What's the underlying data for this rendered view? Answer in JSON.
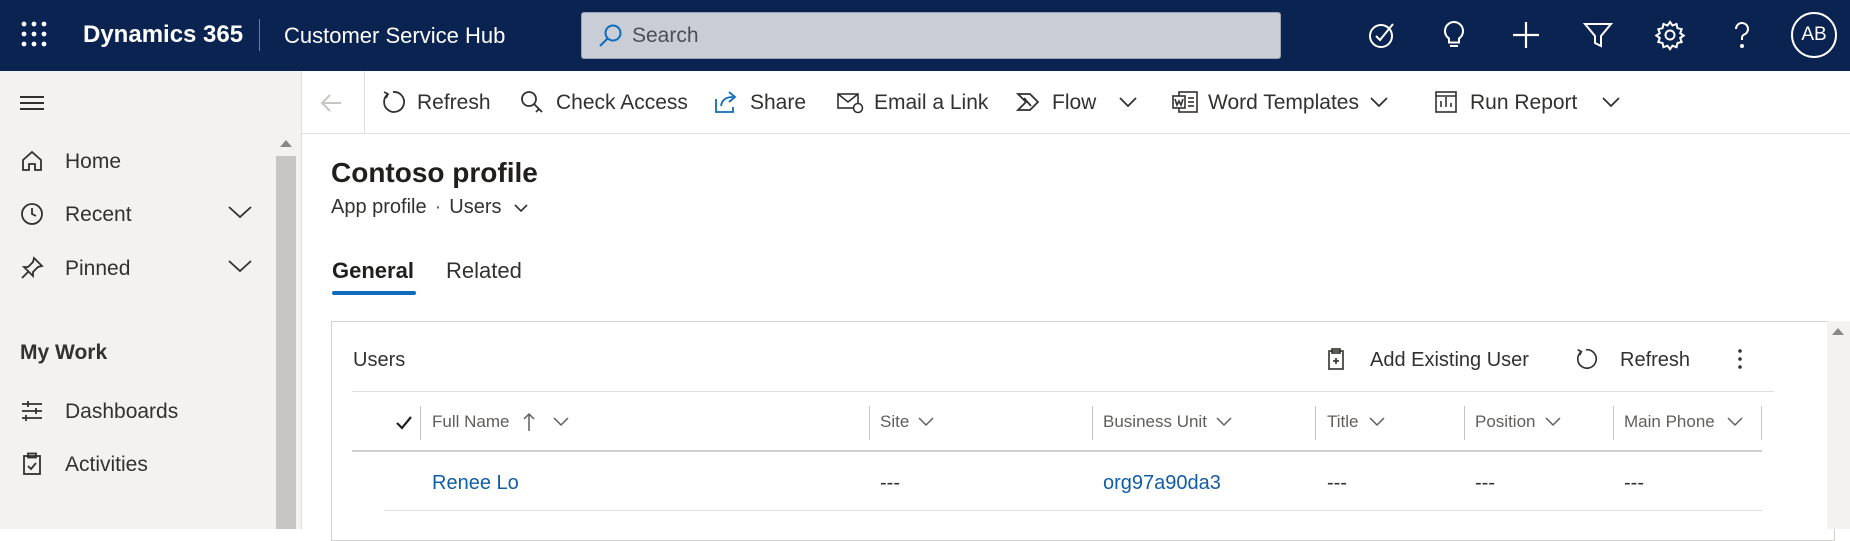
{
  "header": {
    "brand": "Dynamics 365",
    "app_name": "Customer Service Hub",
    "search_placeholder": "Search",
    "icons": [
      "task-check-icon",
      "lightbulb-icon",
      "plus-icon",
      "filter-icon",
      "gear-icon",
      "help-icon"
    ],
    "user_initials": "AB"
  },
  "sidebar": {
    "items": [
      {
        "label": "Home",
        "icon": "home-icon"
      },
      {
        "label": "Recent",
        "icon": "clock-icon",
        "expandable": true
      },
      {
        "label": "Pinned",
        "icon": "pin-icon",
        "expandable": true
      }
    ],
    "section_title": "My Work",
    "work_items": [
      {
        "label": "Dashboards",
        "icon": "dashboard-icon"
      },
      {
        "label": "Activities",
        "icon": "clipboard-icon"
      }
    ]
  },
  "command_bar": {
    "refresh": "Refresh",
    "check_access": "Check Access",
    "share": "Share",
    "email_link": "Email a Link",
    "flow": "Flow",
    "word_templates": "Word Templates",
    "run_report": "Run Report"
  },
  "record": {
    "title": "Contoso profile",
    "entity": "App profile",
    "view": "Users"
  },
  "tabs": [
    {
      "label": "General",
      "selected": true
    },
    {
      "label": "Related",
      "selected": false
    }
  ],
  "subgrid": {
    "title": "Users",
    "add_existing": "Add Existing User",
    "refresh": "Refresh",
    "columns": [
      "Full Name",
      "Site",
      "Business Unit",
      "Title",
      "Position",
      "Main Phone"
    ],
    "sort_column": "Full Name",
    "rows": [
      {
        "full_name": "Renee Lo",
        "site": "---",
        "business_unit": "org97a90da3",
        "title": "---",
        "position": "---",
        "main_phone": "---"
      }
    ]
  },
  "colors": {
    "header_bg": "#0b2350",
    "accent": "#0f6cbd",
    "link": "#115ea3"
  }
}
